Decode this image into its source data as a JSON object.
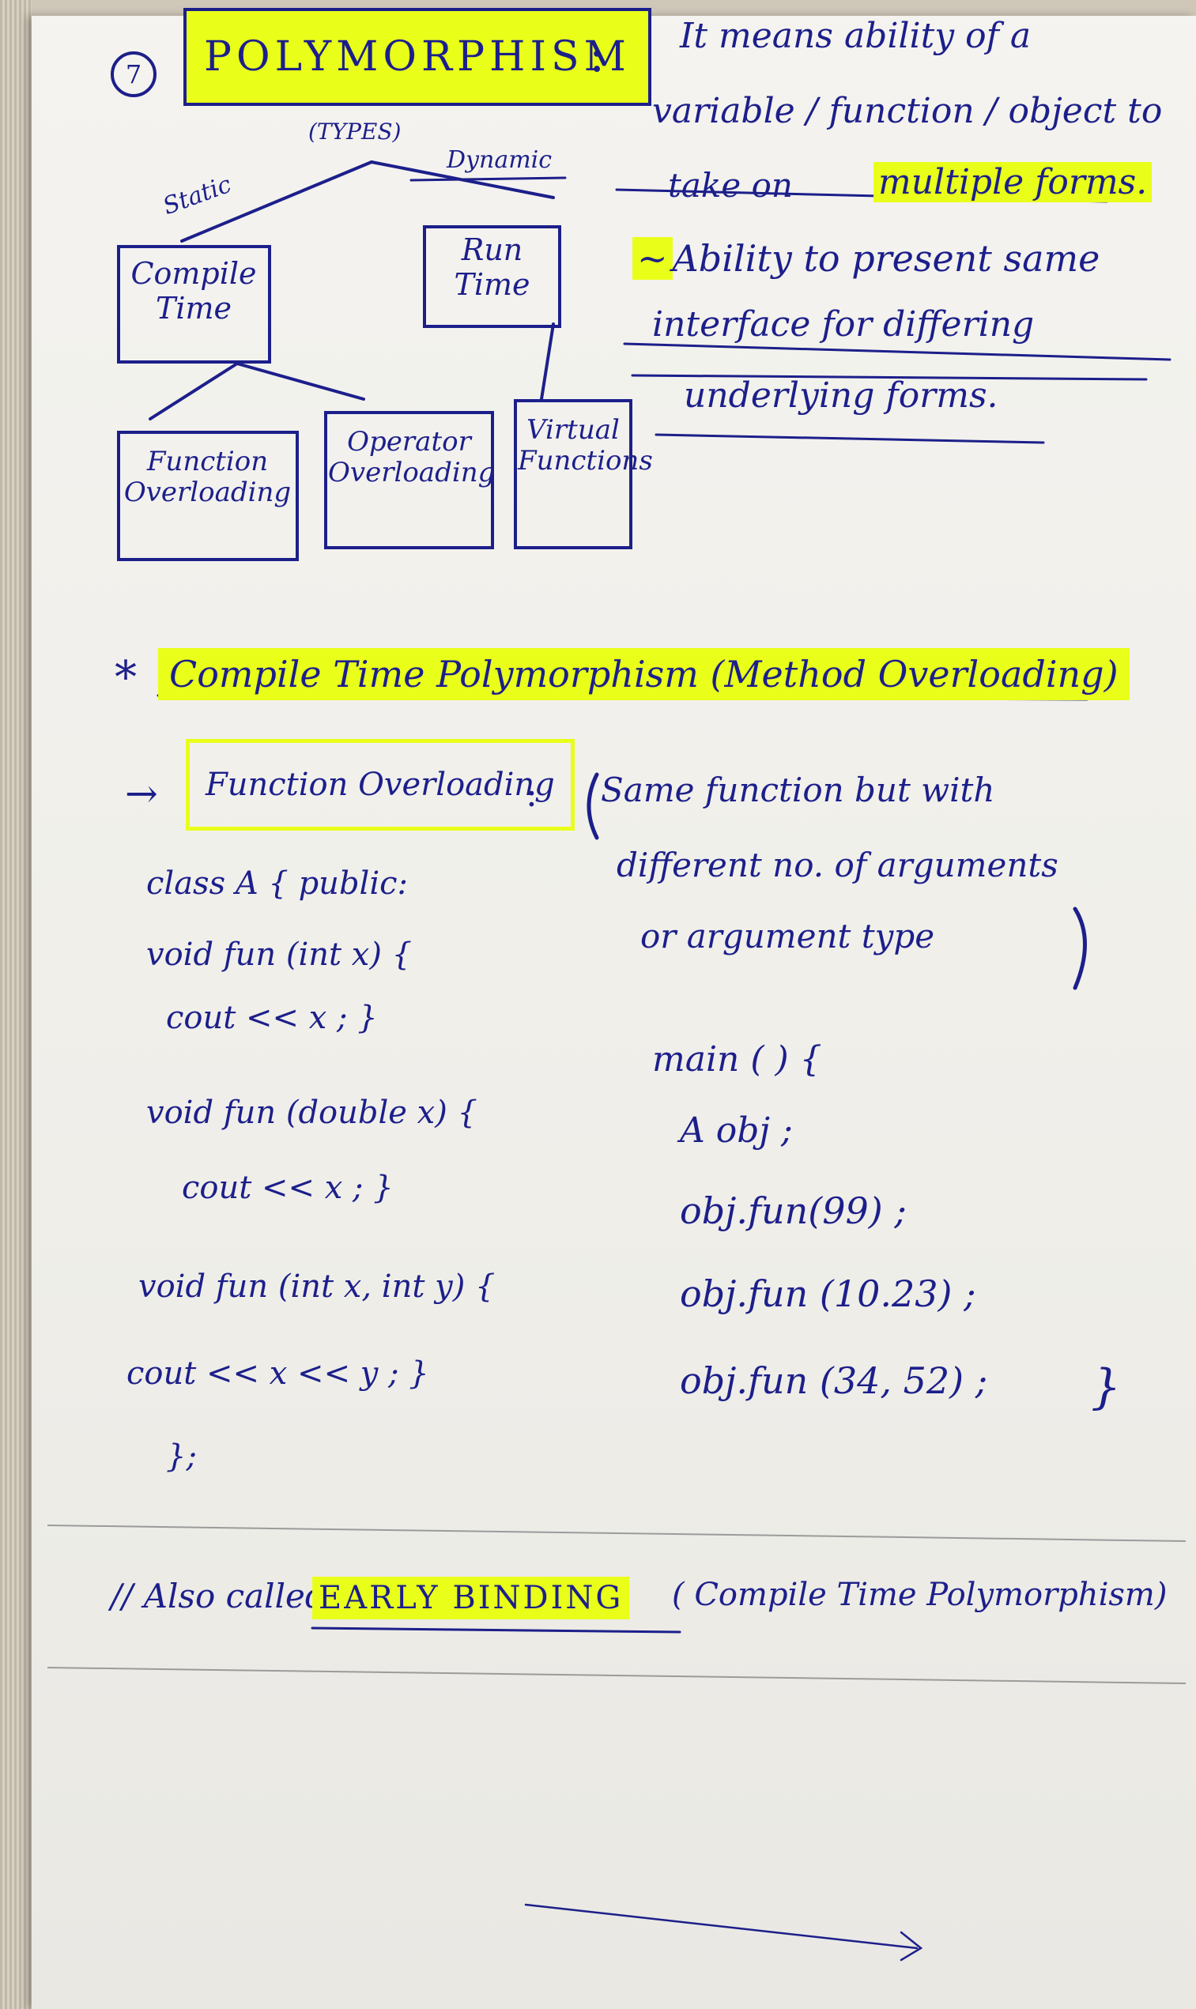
{
  "heading": {
    "number": "7",
    "title": "POLYMORPHISM",
    "colon": ":",
    "def1": "It means ability of a",
    "def2": "variable / function / object to",
    "def3a": "take on",
    "def3b": "multiple forms.",
    "def4": "Ability to present same",
    "def5": "interface for differing",
    "def6": "underlying forms."
  },
  "diagram": {
    "types": "(TYPES)",
    "static": "Static",
    "dynamic": "Dynamic",
    "compile": "Compile Time",
    "runtime": "Run Time",
    "function_overloading": "Function Overloading",
    "operator_overloading": "Operator Overloading",
    "virtual_functions": "Virtual Functions"
  },
  "section": {
    "star": "*",
    "title": "Compile Time Polymorphism (Method Overloading)"
  },
  "overloading": {
    "arrow": "→",
    "label": "Function Overloading",
    "colon": ":",
    "desc1": "Same function but with",
    "desc2": "different no. of arguments",
    "desc3": "or argument type"
  },
  "code_left": [
    "class A { public:",
    "void fun (int x) {",
    "cout << x ; }",
    "void fun (double x) {",
    "cout << x ; }",
    "void fun (int x, int y) {",
    "cout << x << y ; }",
    "};"
  ],
  "code_right": [
    "main ( ) {",
    "A obj ;",
    "obj.fun(99) ;",
    "obj.fun (10.23) ;",
    "obj.fun (34, 52) ;",
    "}"
  ],
  "footer": {
    "prefix": "// Also called",
    "highlight": "EARLY BINDING",
    "suffix": "( Compile Time Polymorphism)"
  },
  "colors": {
    "ink": "#1c1f8a",
    "highlighter": "#e9ff1a",
    "paper": "#f2f1ed"
  }
}
